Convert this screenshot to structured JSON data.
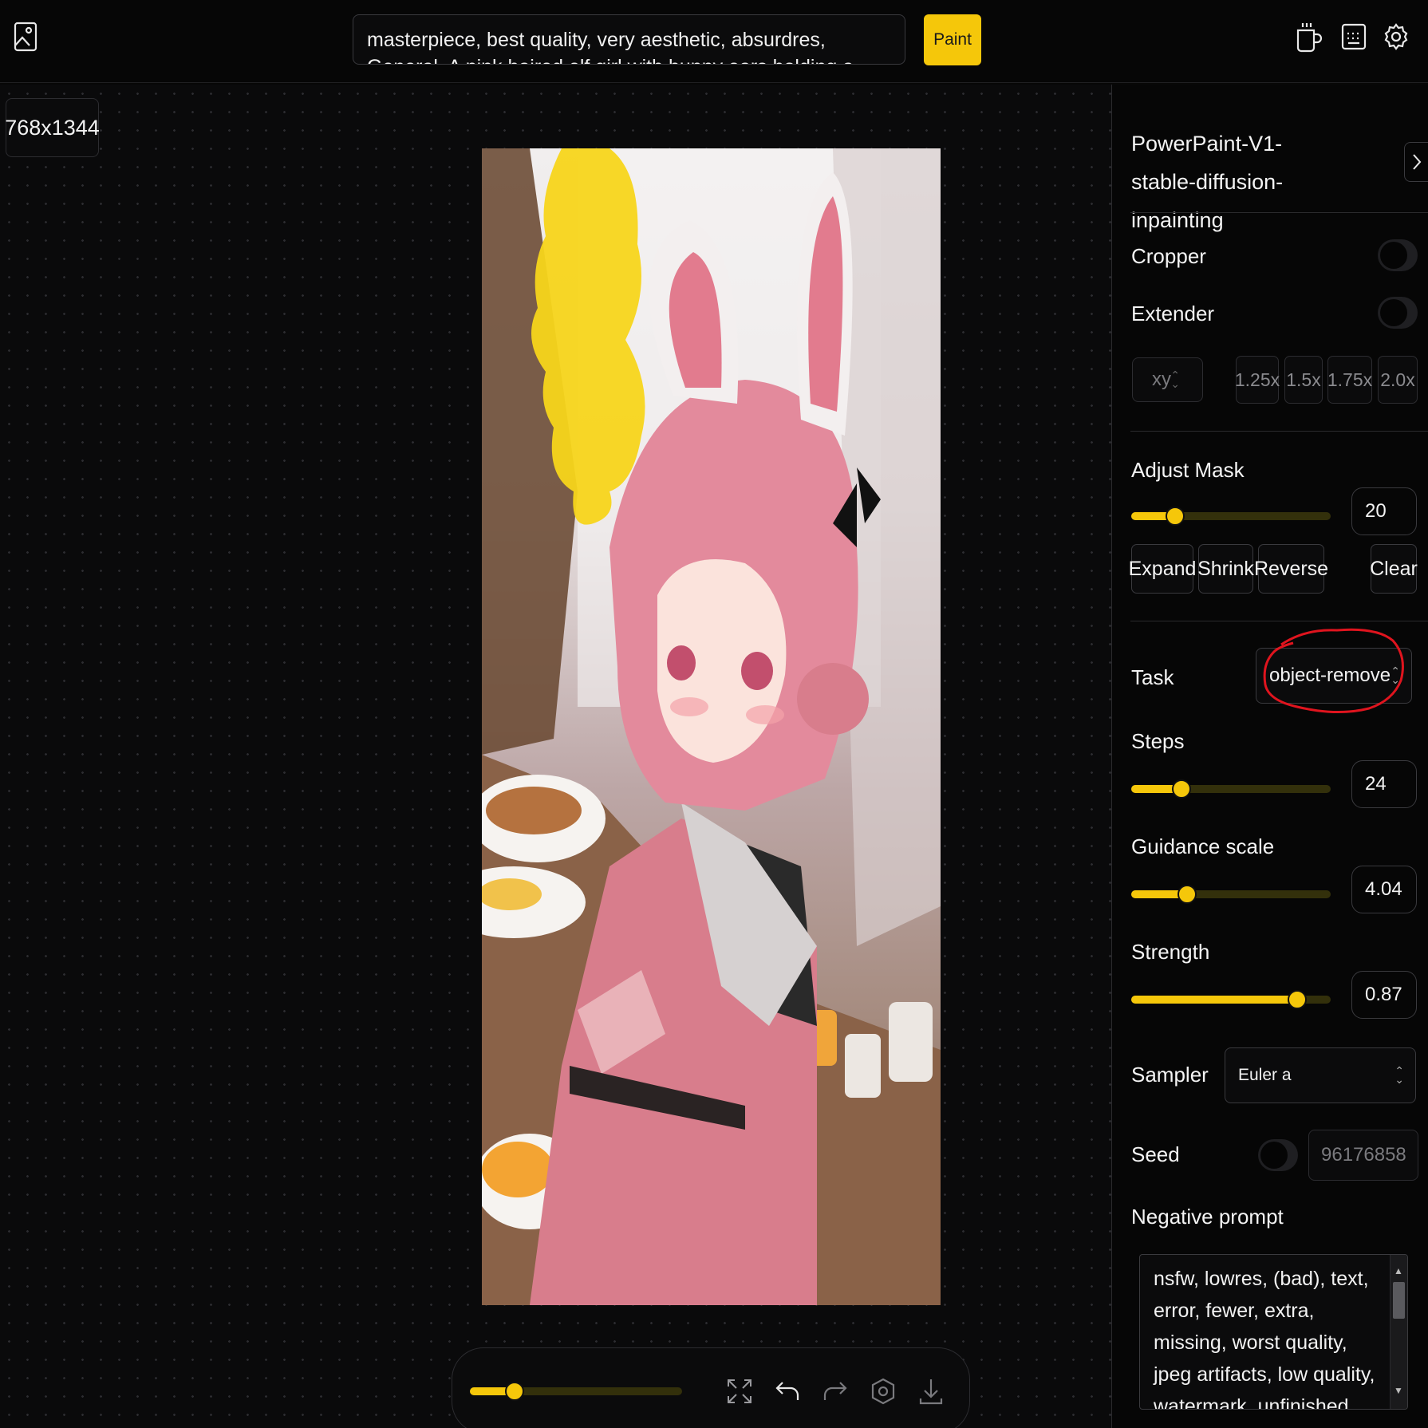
{
  "header": {
    "prompt_text": "masterpiece, best quality, very aesthetic, absurdres, General, A pink haired elf girl with bunny ears holding a tray of food in a cozy cafe, warm lighting",
    "paint_label": "Paint"
  },
  "canvas": {
    "size_badge": "768x1344",
    "brush_size_fraction": 0.21
  },
  "panel": {
    "model_name": "PowerPaint-V1-stable-diffusion-inpainting",
    "cropper_label": "Cropper",
    "extender_label": "Extender",
    "extender_direction": "xy",
    "extender_scales": [
      "1.25x",
      "1.5x",
      "1.75x",
      "2.0x"
    ],
    "adjust_mask_label": "Adjust Mask",
    "adjust_mask_value": "20",
    "mask_buttons": [
      "Expand",
      "Shrink",
      "Reverse",
      "Clear"
    ],
    "task_label": "Task",
    "task_value": "object-remove",
    "steps_label": "Steps",
    "steps_value": "24",
    "guidance_label": "Guidance scale",
    "guidance_value": "4.04",
    "strength_label": "Strength",
    "strength_value": "0.87",
    "sampler_label": "Sampler",
    "sampler_value": "Euler a",
    "seed_label": "Seed",
    "seed_value": "96176858",
    "negative_prompt_label": "Negative prompt",
    "negative_prompt": "nsfw, lowres, (bad), text, error, fewer, extra, missing, worst quality, jpeg artifacts, low quality, watermark, unfinished, displeasing, oldest, early"
  },
  "sliders": {
    "adjust_mask": 0.22,
    "steps": 0.25,
    "guidance": 0.28,
    "strength": 0.83
  },
  "colors": {
    "accent": "#f5c70a",
    "annotation": "#e0141e",
    "background": "#070707"
  },
  "icons": [
    "image-upload-icon",
    "coffee-icon",
    "keyboard-icon",
    "gear-icon",
    "chevron-right-icon",
    "fullscreen-icon",
    "undo-icon",
    "redo-icon",
    "eye-icon",
    "download-icon"
  ]
}
